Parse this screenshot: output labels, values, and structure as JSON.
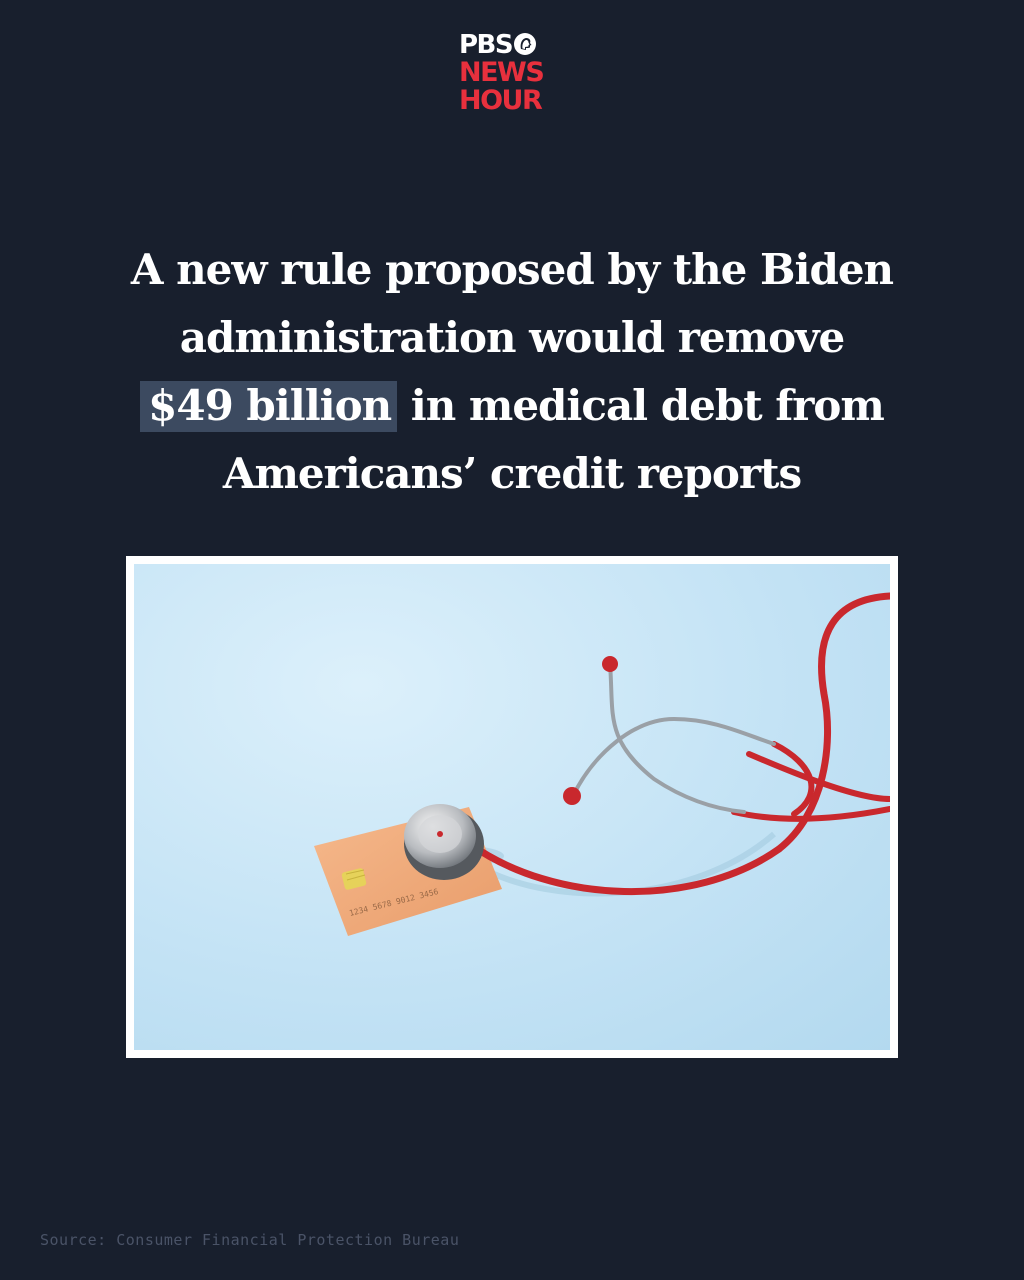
{
  "logo": {
    "line1": "PBS",
    "line2": "NEWS",
    "line3": "HOUR",
    "icon": "pbs-head-icon",
    "colors": {
      "pbs": "#ffffff",
      "news_hour": "#e8303d"
    }
  },
  "headline": {
    "line1": "A new rule proposed by the Biden",
    "line2": "administration would remove",
    "highlight": "$49 billion",
    "line3_rest": " in medical debt from",
    "line4": "Americans’ credit reports"
  },
  "photo": {
    "subject": "stethoscope-on-credit-card-image",
    "card_number_text": "1234 5678 9012 3456"
  },
  "source": "Source: Consumer Financial Protection Bureau",
  "colors": {
    "background": "#181f2d",
    "highlight": "#3c4a60",
    "text": "#ffffff",
    "source_text": "#4a5367"
  }
}
